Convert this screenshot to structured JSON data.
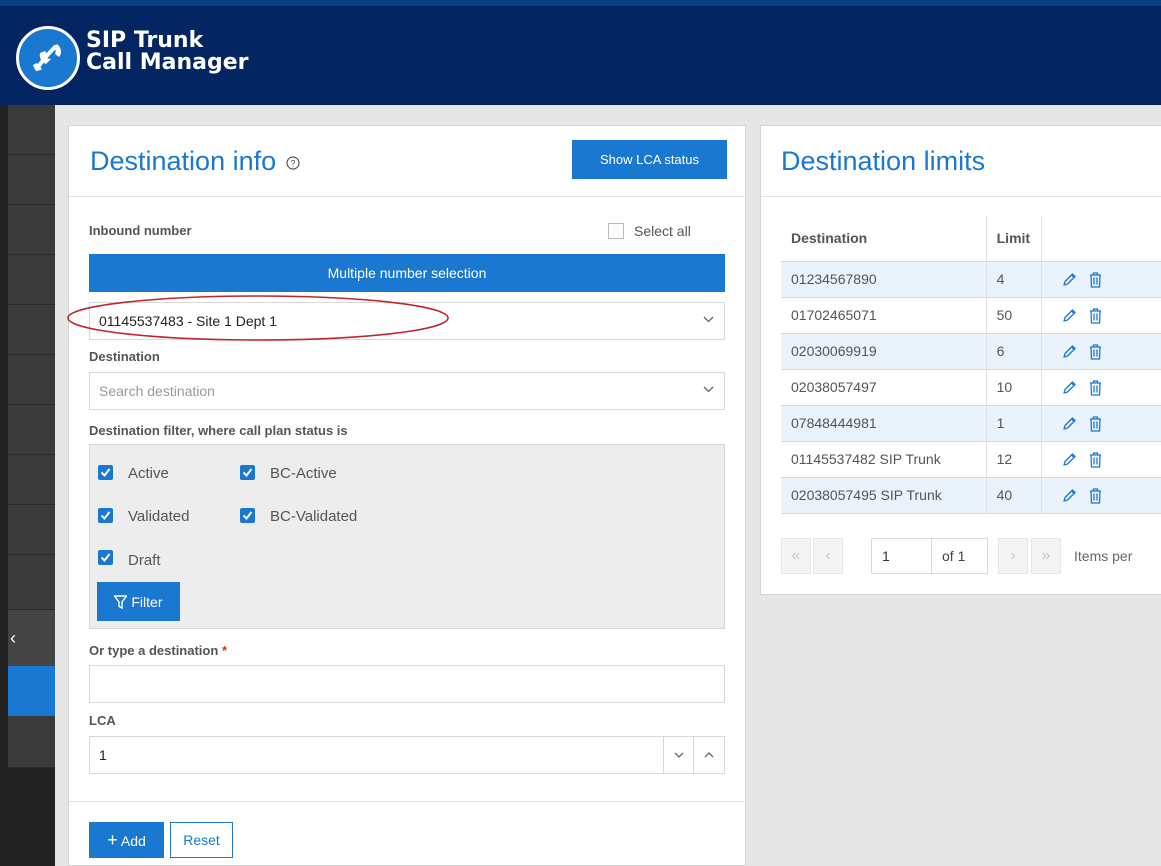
{
  "app": {
    "title_line1": "SIP Trunk",
    "title_line2": "Call Manager"
  },
  "left_panel": {
    "title": "Destination info",
    "help_icon": "question-circle-icon",
    "show_lca_button": "Show LCA status",
    "inbound_label": "Inbound number",
    "select_all_label": "Select all",
    "multiple_selection_button": "Multiple number selection",
    "inbound_selected": "01145537483 - Site 1 Dept 1",
    "destination_label": "Destination",
    "destination_placeholder": "Search destination",
    "filter_label": "Destination filter, where call plan status is",
    "filters": {
      "active": "Active",
      "bc_active": "BC-Active",
      "validated": "Validated",
      "bc_validated": "BC-Validated",
      "draft": "Draft"
    },
    "filter_button": "Filter",
    "type_destination_label": "Or type a destination",
    "required_marker": "*",
    "type_destination_value": "",
    "lca_label": "LCA",
    "lca_value": "1",
    "add_button": "Add",
    "reset_button": "Reset"
  },
  "right_panel": {
    "title": "Destination limits",
    "columns": {
      "destination": "Destination",
      "limit": "Limit"
    },
    "rows": [
      {
        "destination": "01234567890",
        "limit": "4"
      },
      {
        "destination": "01702465071",
        "limit": "50"
      },
      {
        "destination": "02030069919",
        "limit": "6"
      },
      {
        "destination": "02038057497",
        "limit": "10"
      },
      {
        "destination": "07848444981",
        "limit": "1"
      },
      {
        "destination": "01145537482 SIP Trunk",
        "limit": "12"
      },
      {
        "destination": "02038057495 SIP Trunk",
        "limit": "40"
      }
    ],
    "pager": {
      "page": "1",
      "of_label": "of 1",
      "items_label": "Items per"
    }
  },
  "colors": {
    "header": "#032663",
    "accent": "#1b78d0",
    "highlight_ring": "#c0262d"
  }
}
